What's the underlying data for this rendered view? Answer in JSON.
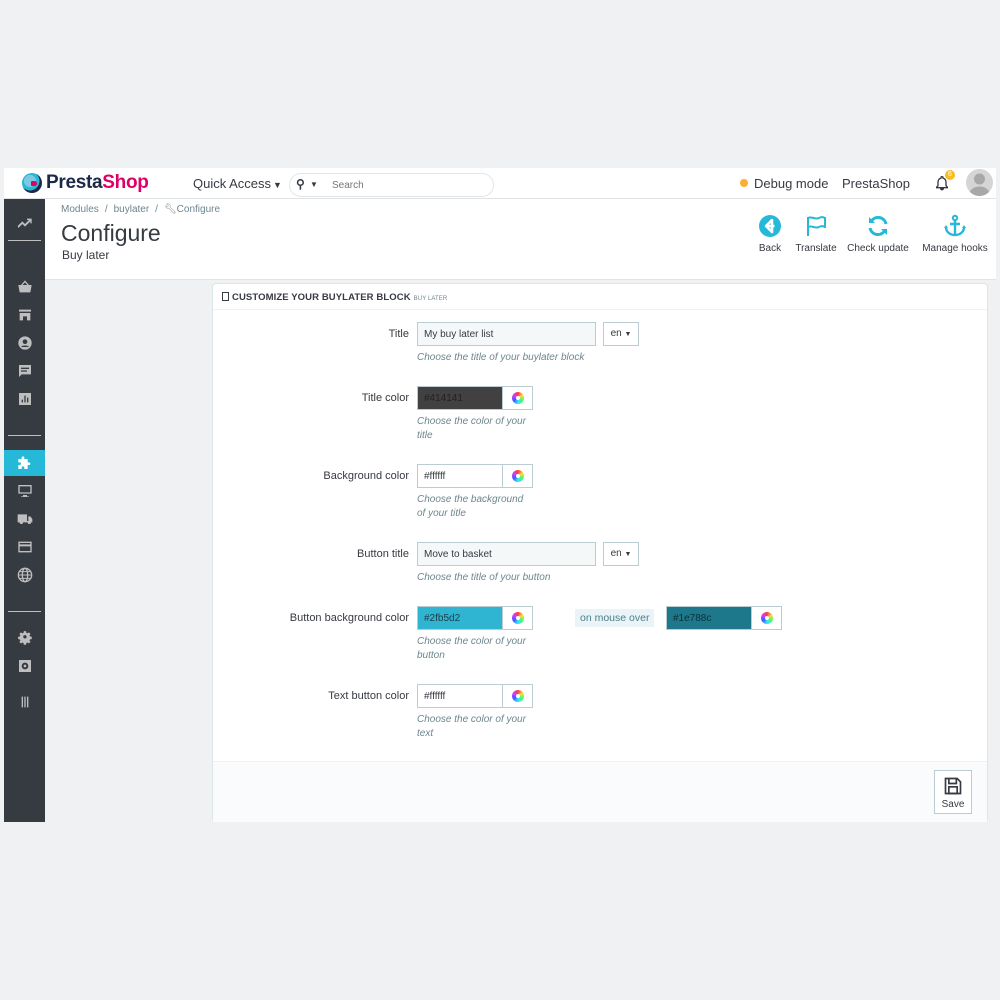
{
  "header": {
    "logo_text_1": "Presta",
    "logo_text_2": "Shop",
    "quick_access": "Quick Access",
    "search_placeholder": "Search",
    "debug_mode": "Debug mode",
    "shop_name": "PrestaShop",
    "notification_count": "6"
  },
  "breadcrumb": {
    "items": [
      "Modules",
      "buylater",
      "Configure"
    ]
  },
  "page": {
    "title": "Configure",
    "subtitle": "Buy later"
  },
  "toolbar": {
    "back": "Back",
    "translate": "Translate",
    "check_update": "Check update",
    "manage_hooks": "Manage hooks"
  },
  "sidebar": {
    "items": [
      "dashboard-icon",
      "orders-icon",
      "catalog-icon",
      "customers-icon",
      "messages-icon",
      "stats-icon",
      "modules-icon",
      "design-icon",
      "shipping-icon",
      "payment-icon",
      "international-icon",
      "settings-icon",
      "advanced-settings-icon",
      "collapse-icon"
    ],
    "active": "modules-icon"
  },
  "panel": {
    "title": "Customize your buylater block",
    "subtitle": "buy later",
    "fields": {
      "title": {
        "label": "Title",
        "value": "My buy later list",
        "lang": "en",
        "help": "Choose the title of your buylater block"
      },
      "title_color": {
        "label": "Title color",
        "value": "#414141",
        "help_1": "Choose the color of your",
        "help_2": "title"
      },
      "background_color": {
        "label": "Background color",
        "value": "#ffffff",
        "help_1": "Choose the background",
        "help_2": "of your title"
      },
      "button_title": {
        "label": "Button title",
        "value": "Move to basket",
        "lang": "en",
        "help": "Choose the title of your button"
      },
      "button_background_color": {
        "label": "Button background color",
        "value": "#2fb5d2",
        "hover_label": "on mouse over",
        "hover_value": "#1e788c",
        "help_1": "Choose the color of your",
        "help_2": "button"
      },
      "text_button_color": {
        "label": "Text button color",
        "value": "#ffffff",
        "help_1": "Choose the color of your",
        "help_2": "text"
      }
    },
    "save_label": "Save"
  },
  "colors": {
    "accent": "#25b9d7",
    "sidebar_bg": "#363a41",
    "brand_pink": "#df0067",
    "title_color_swatch": "#414141",
    "button_bg_swatch": "#2fb5d2",
    "hover_swatch": "#1e788c"
  }
}
